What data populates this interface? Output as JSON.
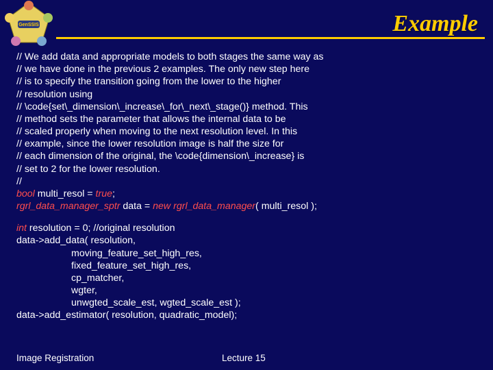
{
  "title": "Example",
  "comments": {
    "c1": "// We add data and appropriate models to both stages the same way as",
    "c2": "// we have done in the previous 2 examples. The only new step here",
    "c3": "// is to specify the transition going from the lower to the higher",
    "c4": "// resolution using",
    "c5": "// \\code{set\\_dimension\\_increase\\_for\\_next\\_stage()} method. This",
    "c6": "// method sets the parameter that allows the internal data to be",
    "c7": "// scaled properly when moving to the next resolution level. In this",
    "c8": "// example, since the lower resolution image is half the size for",
    "c9": "// each dimension of the original, the \\code{dimension\\_increase} is",
    "c10": "// set to 2 for the lower resolution.",
    "c11": "//"
  },
  "code": {
    "l1a": "bool",
    "l1b": " multi_resol = ",
    "l1c": "true",
    "l1d": ";",
    "l2a": "rgrl_data_manager_sptr",
    "l2b": " data = ",
    "l2c": "new",
    "l2d": " ",
    "l2e": "rgrl_data_manager",
    "l2f": "( multi_resol );",
    "l3a": "int",
    "l3b": " resolution = 0;               //original resolution",
    "l4": "data->add_data( resolution,",
    "l5": "moving_feature_set_high_res,",
    "l6": "fixed_feature_set_high_res,",
    "l7": "cp_matcher,",
    "l8": "wgter,",
    "l9": "unwgted_scale_est, wgted_scale_est );",
    "l10": "data->add_estimator( resolution, quadratic_model);"
  },
  "footer": {
    "left": "Image Registration",
    "center": "Lecture 15"
  },
  "logo": {
    "label": "GenSSIS"
  }
}
